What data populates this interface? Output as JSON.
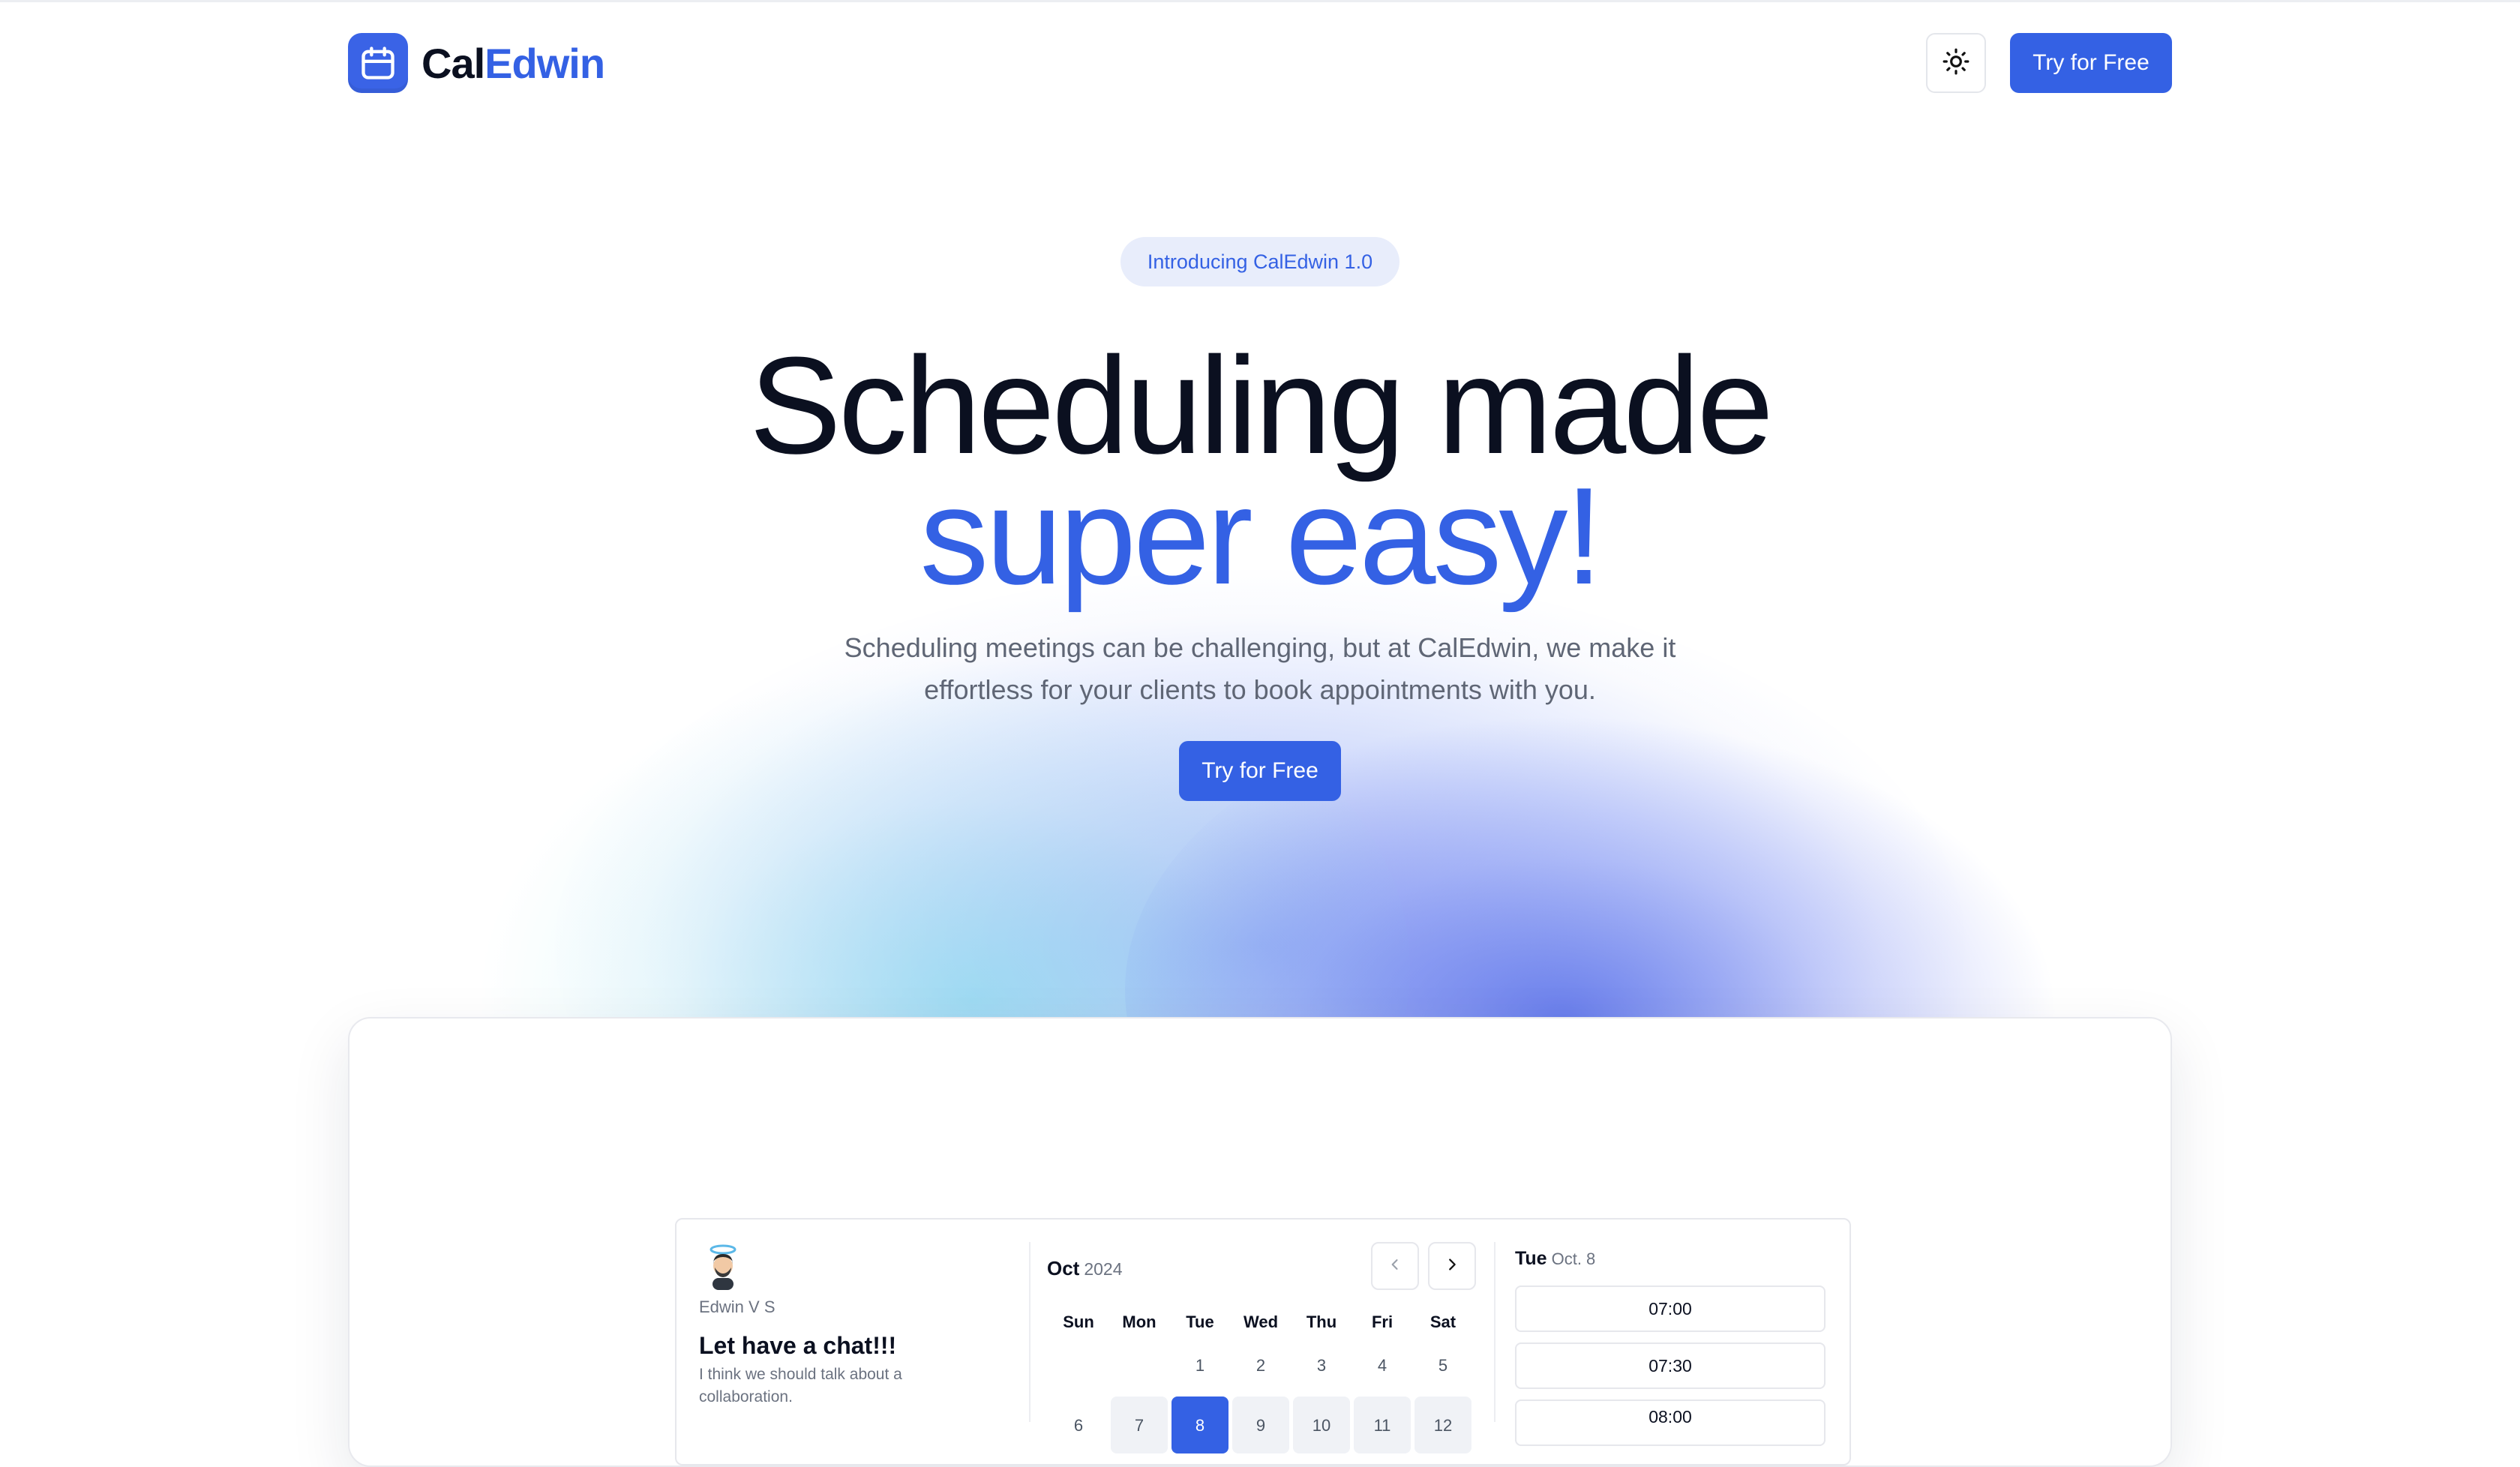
{
  "header": {
    "logo_prefix": "Cal",
    "logo_suffix": "Edwin",
    "cta_label": "Try for Free",
    "brand_color": "#3461e4"
  },
  "hero": {
    "badge": "Introducing CalEdwin 1.0",
    "title_line1": "Scheduling made",
    "title_line2": "super easy!",
    "subtitle_line1": "Scheduling meetings can be challenging, but at CalEdwin, we make it",
    "subtitle_line2": "effortless for your clients to book appointments with you.",
    "cta_label": "Try for Free"
  },
  "booking": {
    "host_name": "Edwin V S",
    "event_title": "Let have a chat!!!",
    "event_description": "I think we should talk about a collaboration.",
    "month": "Oct",
    "year": "2024",
    "weekdays": [
      "Sun",
      "Mon",
      "Tue",
      "Wed",
      "Thu",
      "Fri",
      "Sat"
    ],
    "week1": [
      "1",
      "2",
      "3",
      "4",
      "5"
    ],
    "week2": [
      "6",
      "7",
      "8",
      "9",
      "10",
      "11",
      "12"
    ],
    "selected_day": "8",
    "selected_weekday": "Tue",
    "selected_date": "Oct. 8",
    "time_slots": [
      "07:00",
      "07:30",
      "08:00"
    ]
  },
  "icons": {
    "logo": "calendar-icon",
    "theme": "sun-icon",
    "prev": "chevron-left-icon",
    "next": "chevron-right-icon"
  }
}
